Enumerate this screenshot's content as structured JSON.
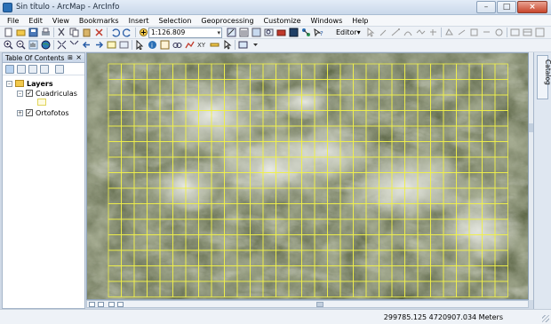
{
  "window": {
    "title": "Sin título - ArcMap - ArcInfo"
  },
  "menu": [
    "File",
    "Edit",
    "View",
    "Bookmarks",
    "Insert",
    "Selection",
    "Geoprocessing",
    "Customize",
    "Windows",
    "Help"
  ],
  "toolbar": {
    "scale_value": "1:126.809",
    "editor_label": "Editor▾"
  },
  "toc": {
    "title": "Table Of Contents",
    "pin": "⊞",
    "close": "×",
    "root": "Layers",
    "layers": [
      {
        "name": "Cuadriculas",
        "checked": true,
        "expanded": true
      },
      {
        "name": "Ortofotos",
        "checked": true,
        "expanded": false
      }
    ]
  },
  "side_tabs": {
    "catalog": "Catalog"
  },
  "status": {
    "coordinates": "299785.125  4720907.034 Meters"
  },
  "colors": {
    "grid_line": "#f0f04a",
    "titlebar": "#cfdcec",
    "map_bg": "#56603e"
  }
}
